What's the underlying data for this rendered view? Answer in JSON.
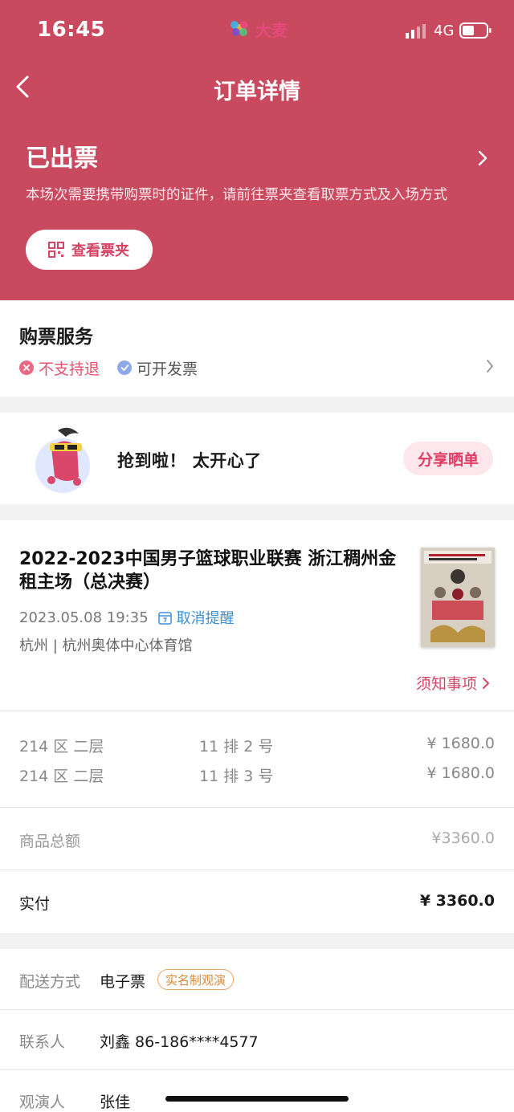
{
  "status_bar": {
    "time": "16:45",
    "brand": "大麦",
    "network": "4G"
  },
  "nav": {
    "title": "订单详情"
  },
  "order": {
    "status": "已出票",
    "description": "本场次需要携带购票时的证件，请前往票夹查看取票方式及入场方式",
    "ticket_button": "查看票夹"
  },
  "service": {
    "title": "购票服务",
    "no_refund": "不支持退",
    "invoice": "可开发票"
  },
  "share": {
    "text": "抢到啦！ 太开心了",
    "button": "分享晒单"
  },
  "event": {
    "title": "2022-2023中国男子篮球职业联赛 浙江稠州金租主场（总决赛）",
    "datetime": "2023.05.08 19:35",
    "remind": "取消提醒",
    "venue": "杭州 | 杭州奥体中心体育馆",
    "notice": "须知事项"
  },
  "seats": [
    {
      "area": "214 区 二层",
      "seat": "11 排 2 号",
      "price": "¥ 1680.0"
    },
    {
      "area": "214 区 二层",
      "seat": "11 排 3 号",
      "price": "¥ 1680.0"
    }
  ],
  "totals": {
    "goods_label": "商品总额",
    "goods_value": "¥3360.0",
    "paid_label": "实付",
    "paid_value": "¥ 3360.0"
  },
  "delivery": {
    "method_label": "配送方式",
    "method_value": "电子票",
    "realname_tag": "实名制观演",
    "contact_label": "联系人",
    "contact_value": "刘鑫  86-186****4577",
    "viewer_label": "观演人",
    "viewer_value": "张佳"
  },
  "colors": {
    "hero": "#c9495f",
    "accent": "#d64565",
    "link": "#3d8fd8"
  }
}
